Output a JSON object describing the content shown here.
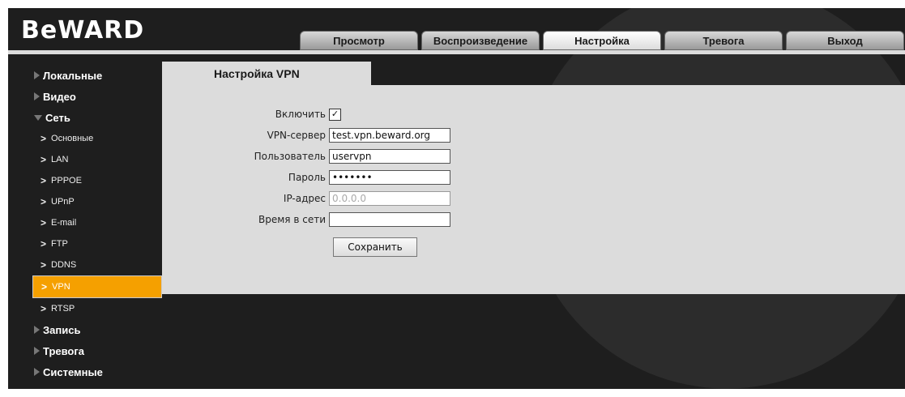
{
  "brand": {
    "logo_text": "BeWARD"
  },
  "tabs": [
    {
      "label": "Просмотр",
      "active": false
    },
    {
      "label": "Воспроизведение",
      "active": false
    },
    {
      "label": "Настройка",
      "active": true
    },
    {
      "label": "Тревога",
      "active": false
    },
    {
      "label": "Выход",
      "active": false
    }
  ],
  "sidebar": {
    "groups": [
      {
        "label": "Локальные",
        "expanded": false
      },
      {
        "label": "Видео",
        "expanded": false
      },
      {
        "label": "Сеть",
        "expanded": true,
        "items": [
          "Основные",
          "LAN",
          "PPPOE",
          "UPnP",
          "E-mail",
          "FTP",
          "DDNS",
          "VPN",
          "RTSP"
        ],
        "active_item": "VPN"
      },
      {
        "label": "Запись",
        "expanded": false
      },
      {
        "label": "Тревога",
        "expanded": false
      },
      {
        "label": "Системные",
        "expanded": false
      }
    ]
  },
  "panel": {
    "title": "Настройка VPN",
    "fields": {
      "enable_label": "Включить",
      "enable_checked": true,
      "server_label": "VPN-сервер",
      "server_value": "test.vpn.beward.org",
      "user_label": "Пользователь",
      "user_value": "uservpn",
      "password_label": "Пароль",
      "password_value": "•••••••",
      "ip_label": "IP-адрес",
      "ip_value": "0.0.0.0",
      "time_label": "Время в сети",
      "time_value": ""
    },
    "save_label": "Сохранить"
  },
  "colors": {
    "accent": "#f5a000",
    "background": "#1e1e1e",
    "panel": "#dcdcdc"
  }
}
